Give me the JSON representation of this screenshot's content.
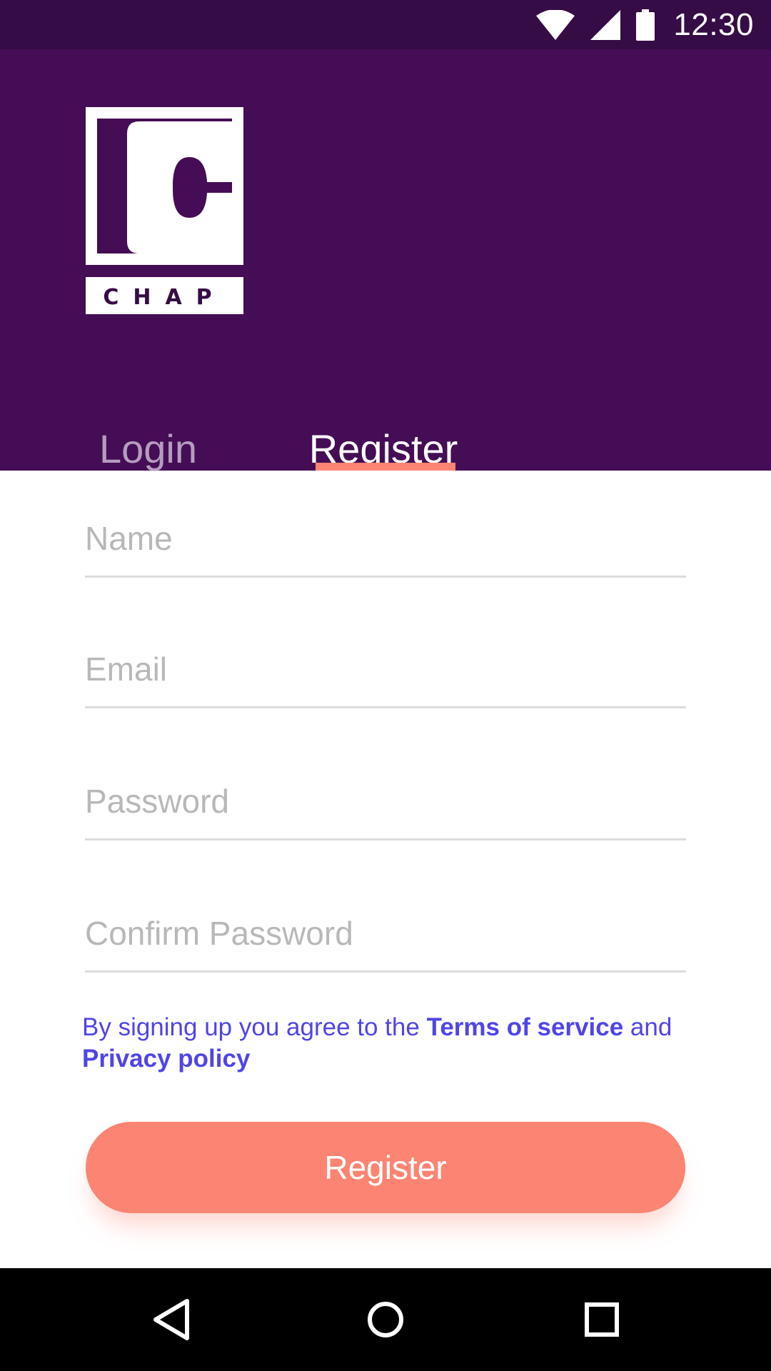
{
  "status_bar": {
    "time": "12:30",
    "icons": [
      "wifi-icon",
      "cellular-signal-icon",
      "battery-icon"
    ]
  },
  "header": {
    "logo_text": "CHAP",
    "tabs": [
      {
        "label": "Login",
        "active": false
      },
      {
        "label": "Register",
        "active": true
      }
    ]
  },
  "form": {
    "name_placeholder": "Name",
    "email_placeholder": "Email",
    "password_placeholder": "Password",
    "confirm_password_placeholder": "Confirm Password",
    "terms_prefix": "By signing up you agree to the ",
    "terms_link": "Terms of service",
    "terms_and": " and",
    "privacy_link": "Privacy policy",
    "submit_label": "Register"
  },
  "nav_bar": {
    "icons": [
      "back-icon",
      "home-icon",
      "recents-icon"
    ]
  },
  "colors": {
    "status_bar": "#350c46",
    "header": "#450d55",
    "accent": "#fb8572",
    "link": "#4f45e8",
    "inactive_tab": "#b59cc0"
  }
}
